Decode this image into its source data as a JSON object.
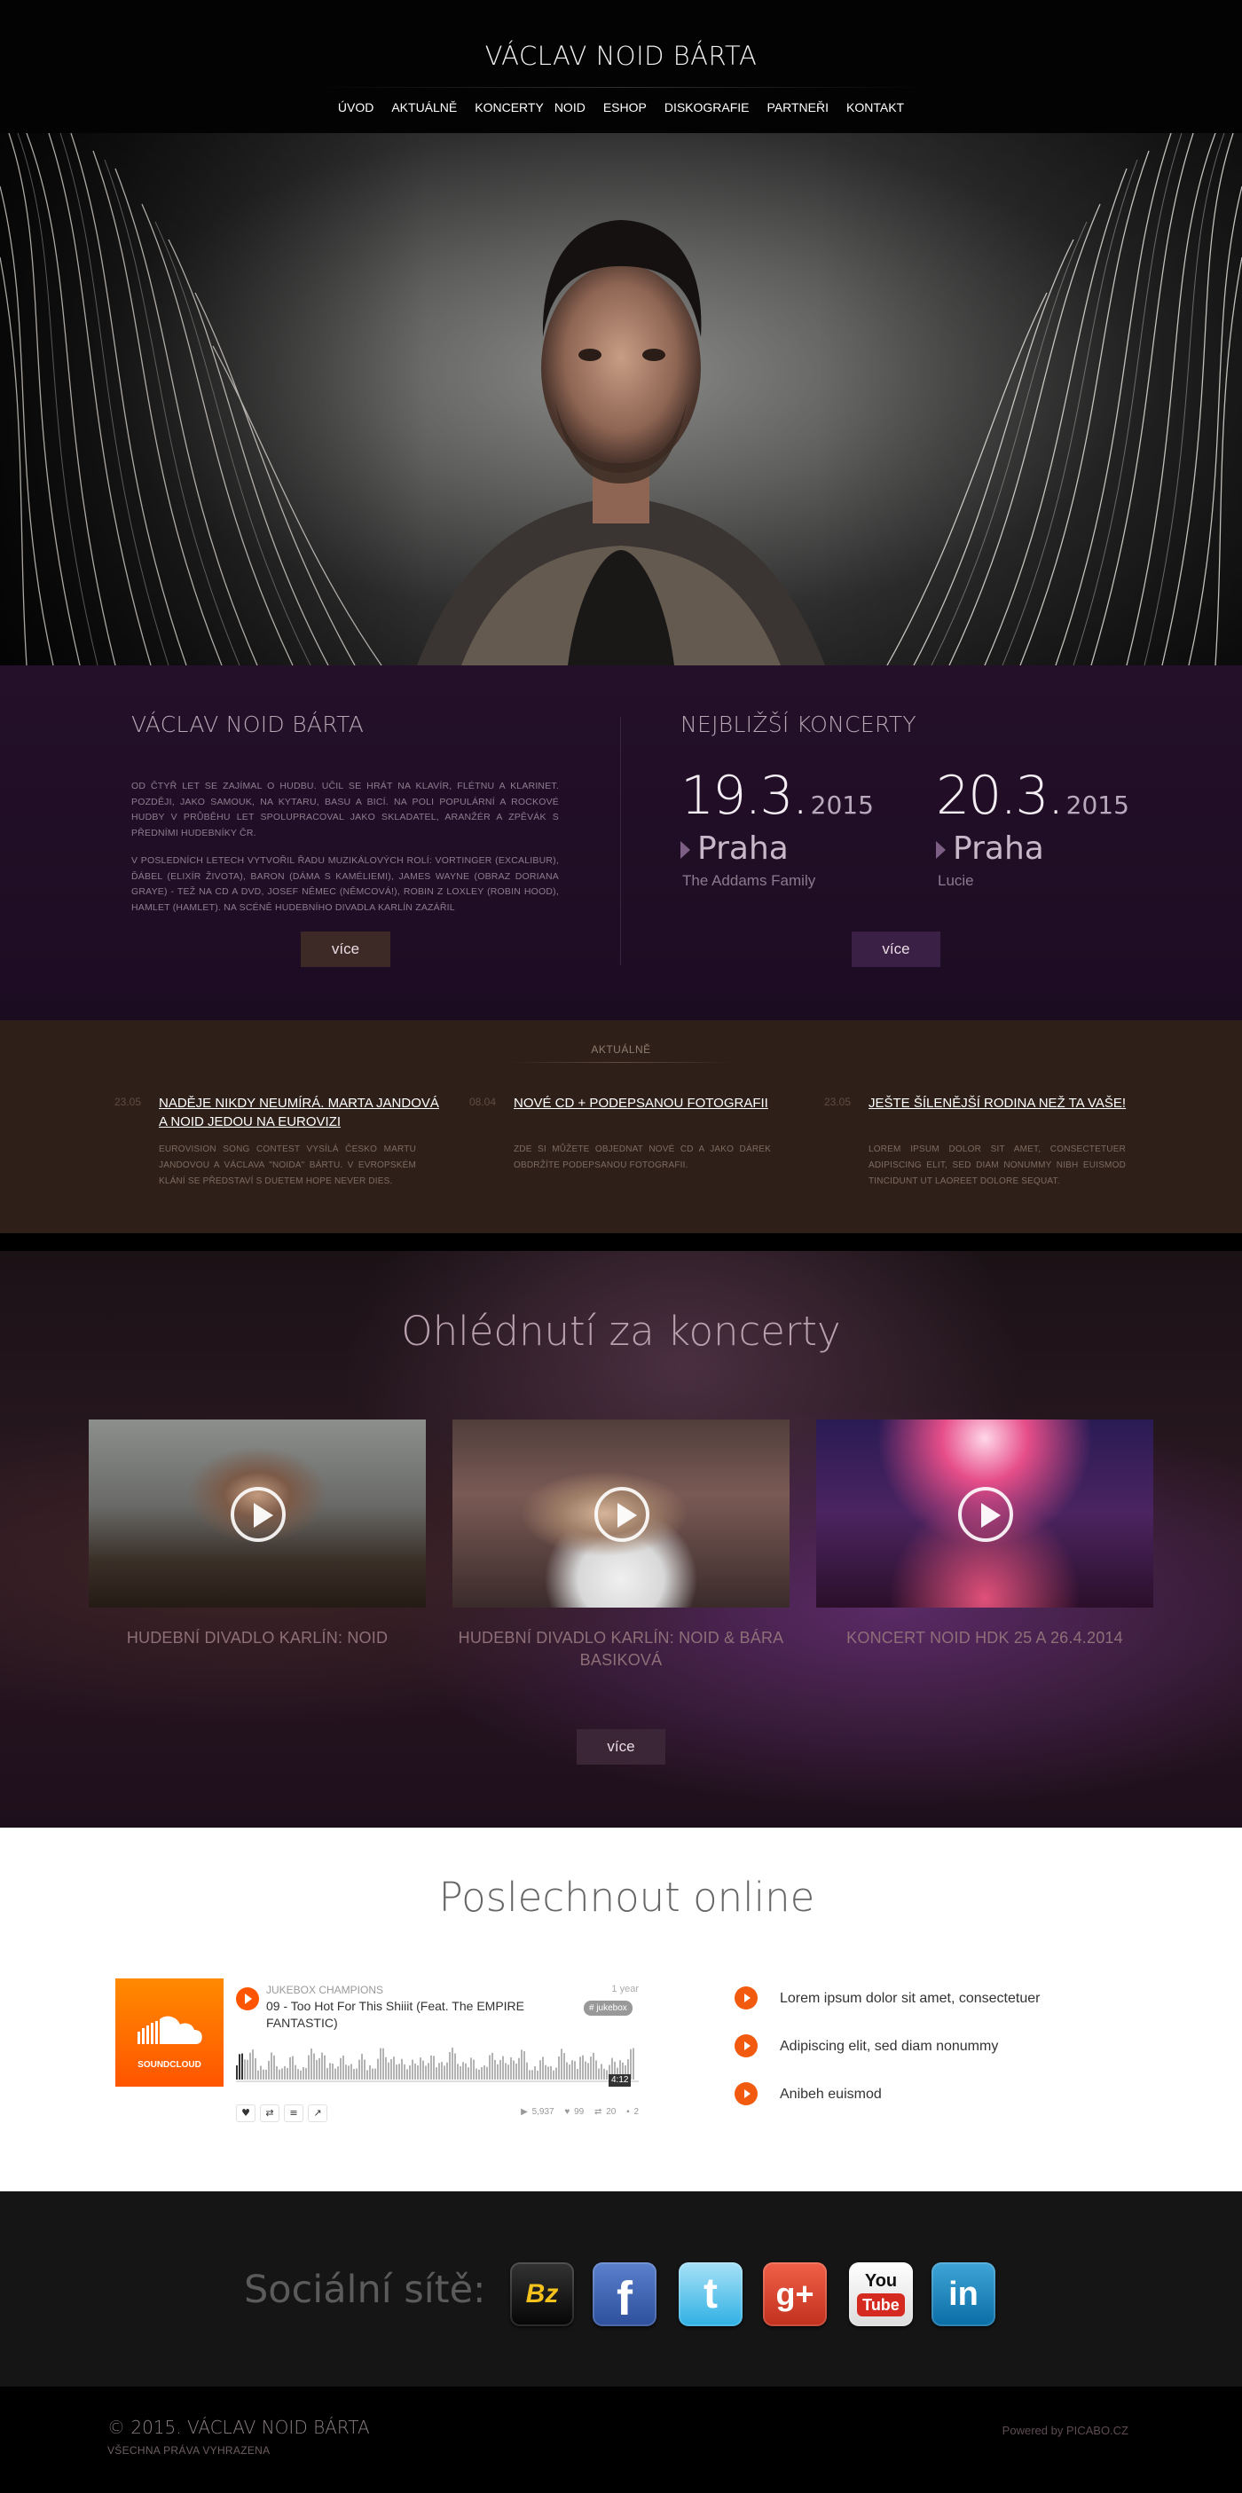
{
  "header": {
    "title": "VÁCLAV NOID BÁRTA",
    "nav": [
      "ÚVOD",
      "AKTUÁLNĚ",
      "KONCERTY",
      "NOID",
      "ESHOP",
      "DISKOGRAFIE",
      "PARTNEŘI",
      "KONTAKT"
    ]
  },
  "intro": {
    "heading": "VÁCLAV NOID BÁRTA",
    "paragraph_1": "OD ČTYŘ LET SE ZAJÍMAL O HUDBU. UČIL SE HRÁT NA KLAVÍR, FLÉTNU A KLARINET. POZDĚJI, JAKO SAMOUK, NA KYTARU, BASU A BICÍ. NA POLI POPULÁRNÍ A ROCKOVÉ HUDBY V PRŮBĚHU LET SPOLUPRACOVAL JAKO SKLADATEL, ARANŽÉR A ZPĚVÁK S PŘEDNÍMI HUDEBNÍKY ČR.",
    "paragraph_2": "V POSLEDNÍCH LETECH VYTVOŘIL ŘADU MUZIKÁLOVÝCH ROLÍ: VORTINGER (EXCALIBUR), ĎÁBEL (ELIXÍR ŽIVOTA), BARON (DÁMA S KAMÉLIEMI), JAMES WAYNE (OBRAZ DORIANA GRAYE) - TEŽ NA CD A DVD, JOSEF NĚMEC (NĚMCOVÁ!), ROBIN Z LOXLEY (ROBIN HOOD), HAMLET (HAMLET). NA SCÉNĚ HUDEBNÍHO DIVADLA KARLÍN ZAZÁŘIL",
    "more_label": "více"
  },
  "concerts": {
    "heading": "NEJBLIŽŠÍ KONCERTY",
    "items": [
      {
        "day": "19.3.",
        "year": "2015",
        "city": "Praha",
        "show": "The Addams Family"
      },
      {
        "day": "20.3.",
        "year": "2015",
        "city": "Praha",
        "show": "Lucie"
      }
    ],
    "more_label": "více"
  },
  "news": {
    "label": "AKTUÁLNĚ",
    "items": [
      {
        "date": "23.05",
        "title": "NADĚJE NIKDY NEUMÍRÁ. MARTA JANDOVÁ A NOID JEDOU NA EUROVIZI",
        "body": "EUROVISION SONG CONTEST VYSÍLÁ ČESKO MARTU JANDOVOU A VÁCLAVA \"NOIDA\" BÁRTU. V EVROPSKÉM KLÁNÍ SE PŘEDSTAVÍ S DUETEM HOPE NEVER DIES."
      },
      {
        "date": "08.04",
        "title": "NOVÉ CD + PODEPSANOU FOTOGRAFII",
        "body": "ZDE SI MŮŽETE OBJEDNAT NOVÉ CD A JAKO DÁREK OBDRŽÍTE PODEPSANOU FOTOGRAFII."
      },
      {
        "date": "23.05",
        "title": "JEŠTE ŠÍLENĚJŠÍ RODINA NEŽ TA VAŠE!",
        "body": "LOREM IPSUM DOLOR SIT AMET, CONSECTETUER ADIPISCING ELIT, SED DIAM NONUMMY NIBH EUISMOD TINCIDUNT UT LAOREET DOLORE SEQUAT."
      }
    ]
  },
  "reviews": {
    "heading": "Ohlédnutí za koncerty",
    "videos": [
      {
        "caption": "HUDEBNÍ DIVADLO KARLÍN: NOID"
      },
      {
        "caption": "HUDEBNÍ DIVADLO KARLÍN: NOID & BÁRA BASIKOVÁ"
      },
      {
        "caption": "KONCERT NOID HDK 25 A 26.4.2014"
      }
    ],
    "more_label": "více"
  },
  "listen": {
    "heading": "Poslechnout online",
    "player": {
      "brand": "SOUNDCLOUD",
      "artist": "JUKEBOX CHAMPIONS",
      "age": "1 year",
      "track": "09 - Too Hot For This Shiiit (Feat. The EMPIRE FANTASTIC)",
      "tag": "# jukebox",
      "duration": "4:12",
      "plays": "5,937",
      "likes": "99",
      "reposts": "20",
      "comments": "2",
      "accent_color": "#ff5500"
    },
    "bullets": [
      "Lorem ipsum dolor sit amet, consectetuer",
      "Adipiscing elit, sed diam nonummy",
      "Anibeh euismod"
    ]
  },
  "social": {
    "label": "Sociální sítě:",
    "icons": [
      {
        "name": "bandzone-icon",
        "glyph": "Bz"
      },
      {
        "name": "facebook-icon",
        "glyph": "f"
      },
      {
        "name": "twitter-icon",
        "glyph": "t"
      },
      {
        "name": "google-plus-icon",
        "glyph": "g+"
      },
      {
        "name": "youtube-icon",
        "glyph_top": "You",
        "glyph_bottom": "Tube"
      },
      {
        "name": "linkedin-icon",
        "glyph": "in"
      }
    ]
  },
  "footer": {
    "copyright": "© 2015. VÁCLAV NOID BÁRTA",
    "rights": "VŠECHNA PRÁVA VYHRAZENA",
    "powered": "Powered by PICABO.CZ"
  }
}
